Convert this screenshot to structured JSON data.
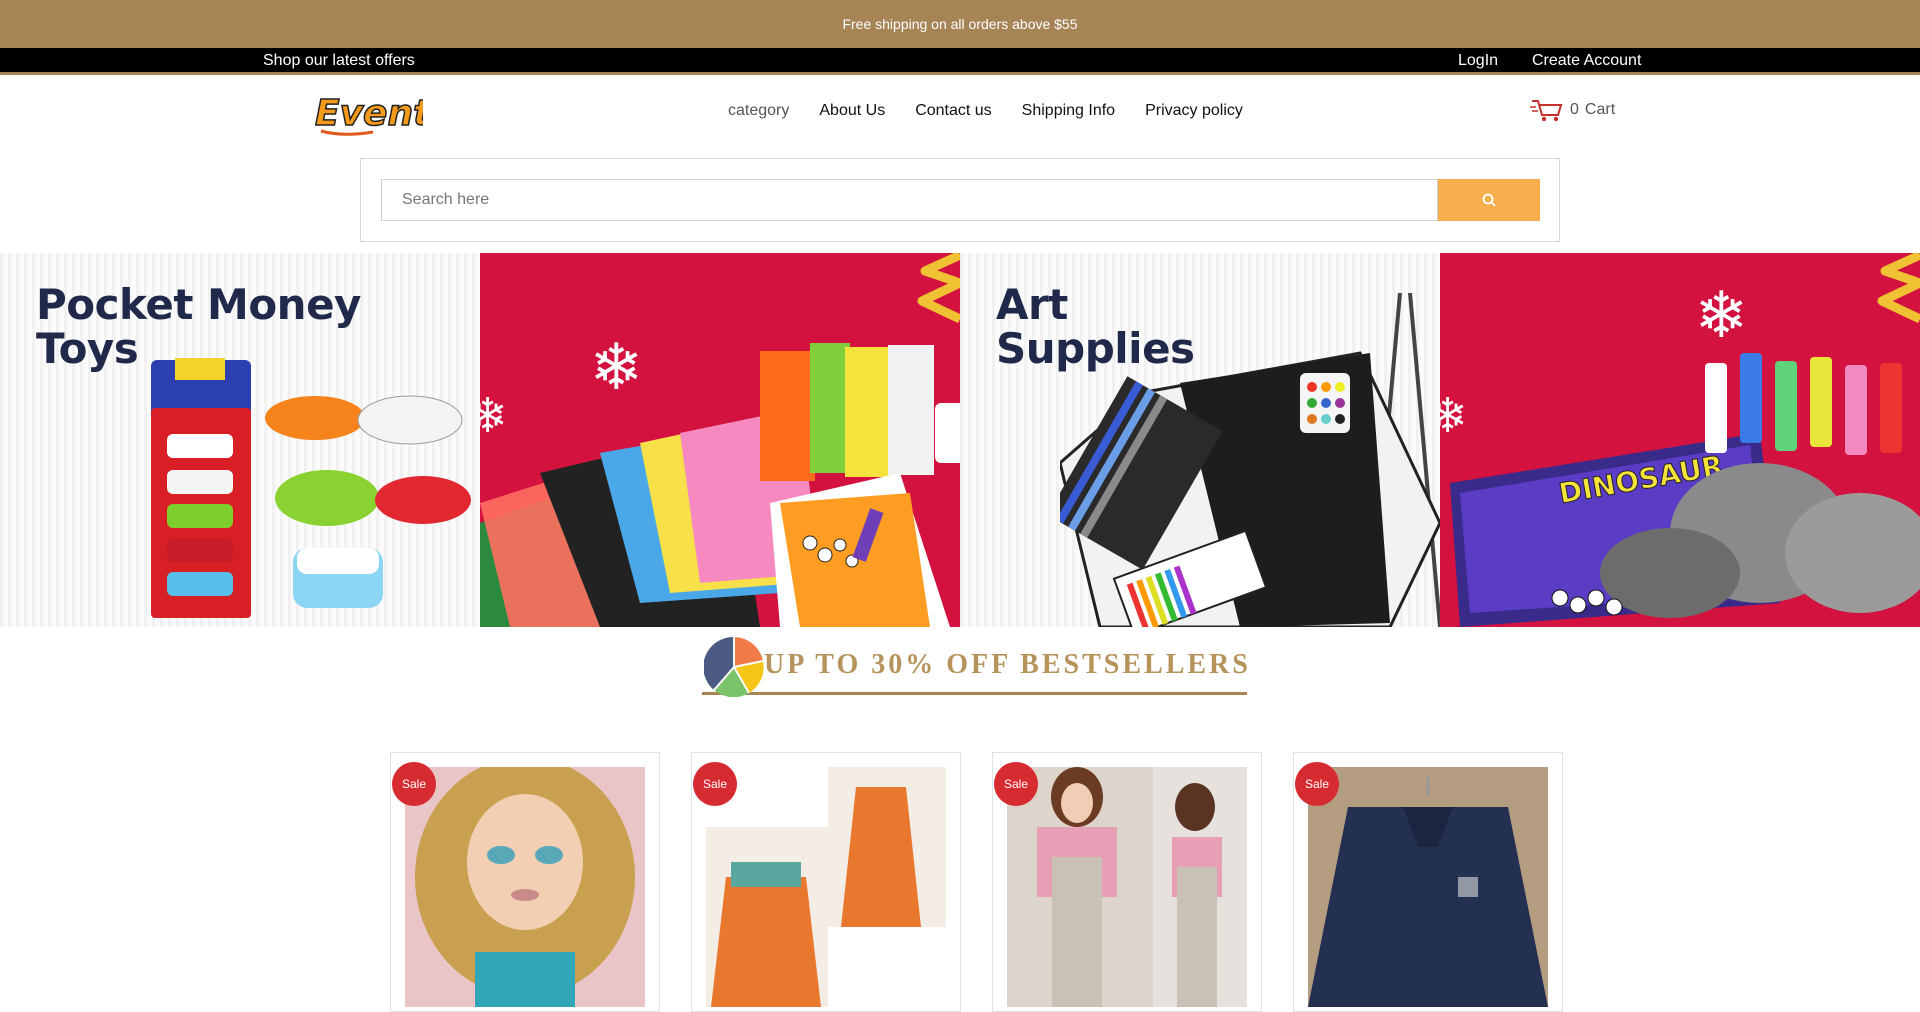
{
  "announcement": "Free shipping on all orders above $55",
  "topbar": {
    "offers": "Shop our latest offers",
    "login": "LogIn",
    "create_account": "Create Account"
  },
  "logo_text": "Event",
  "nav": [
    "category",
    "About Us",
    "Contact us",
    "Shipping Info",
    "Privacy policy"
  ],
  "cart": {
    "count": "0",
    "label": "Cart",
    "icon": "cart-icon"
  },
  "search": {
    "placeholder": "Search here",
    "icon": "search-icon",
    "button_color": "#f9ae4d"
  },
  "banners": [
    {
      "title_line1": "Pocket Money",
      "title_line2": "Toys",
      "style": "white"
    },
    {
      "style": "red"
    },
    {
      "title_line1": "Art",
      "title_line2": "Supplies",
      "style": "white"
    },
    {
      "style": "red"
    }
  ],
  "section_heading": "UP TO 30% OFF BESTSELLERS",
  "products": [
    {
      "badge": "Sale",
      "image": "doll"
    },
    {
      "badge": "Sale",
      "image": "orange-dress"
    },
    {
      "badge": "Sale",
      "image": "plaid-jumpsuit"
    },
    {
      "badge": "Sale",
      "image": "navy-jacket"
    }
  ],
  "colors": {
    "accent": "#a78455",
    "sale": "#d72b32",
    "banner_red": "#d3123f",
    "navy": "#20294a"
  }
}
